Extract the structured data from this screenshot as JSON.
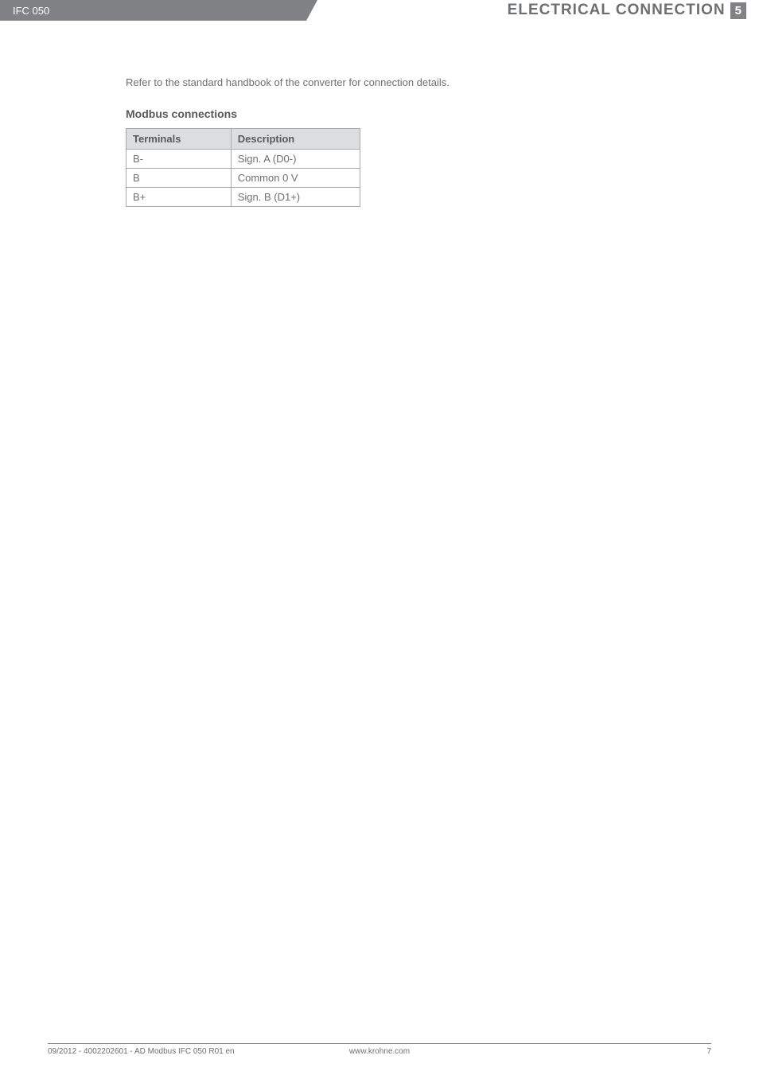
{
  "header": {
    "left_label": "IFC 050",
    "title": "ELECTRICAL CONNECTION",
    "section_number": "5"
  },
  "intro": "Refer to the standard handbook of the converter for connection details.",
  "section_title": "Modbus connections",
  "table": {
    "headers": [
      "Terminals",
      "Description"
    ],
    "rows": [
      [
        "B-",
        "Sign. A (D0-)"
      ],
      [
        "B",
        "Common 0 V"
      ],
      [
        "B+",
        "Sign. B (D1+)"
      ]
    ]
  },
  "footer": {
    "left": "09/2012 - 4002202601 - AD Modbus IFC 050 R01 en",
    "center": "www.krohne.com",
    "right": "7"
  }
}
